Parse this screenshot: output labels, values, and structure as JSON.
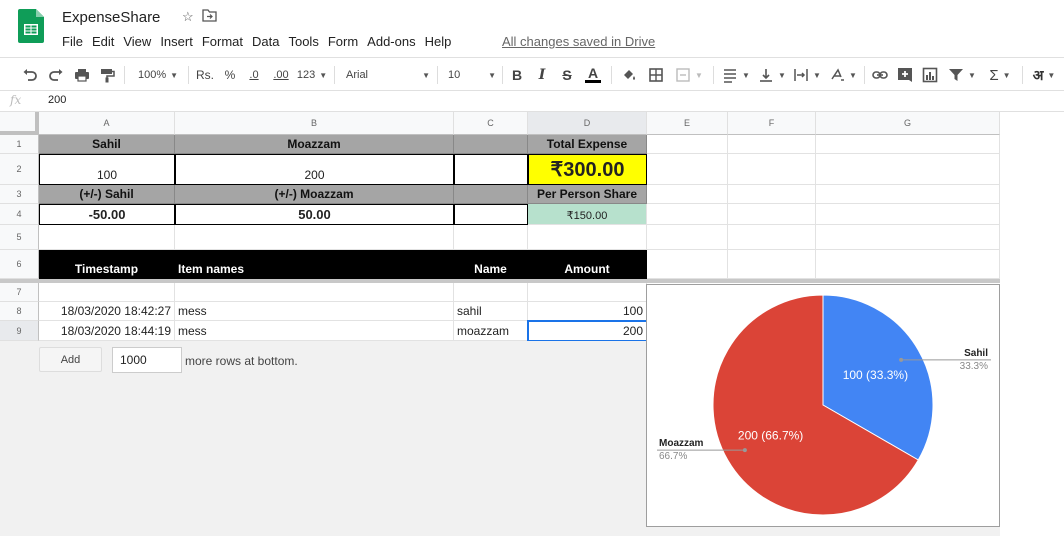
{
  "app": {
    "doc_title": "ExpenseShare",
    "saved_status": "All changes saved in Drive",
    "menu": [
      "File",
      "Edit",
      "View",
      "Insert",
      "Format",
      "Data",
      "Tools",
      "Form",
      "Add-ons",
      "Help"
    ]
  },
  "toolbar": {
    "zoom": "100%",
    "currency": "Rs.",
    "percent": "%",
    "dec_decrease": ".0",
    "dec_increase": ".00",
    "number_format": "123",
    "font": "Arial",
    "font_size": "10",
    "bold": "B",
    "italic": "I",
    "strike": "S",
    "text_color": "A",
    "sigma": "Σ",
    "input_tools": "अ"
  },
  "formula_bar": {
    "fx": "fx",
    "value": "200"
  },
  "columns": [
    "A",
    "B",
    "C",
    "D",
    "E",
    "F",
    "G"
  ],
  "rows": [
    "1",
    "2",
    "3",
    "4",
    "5",
    "6",
    "7",
    "8",
    "9"
  ],
  "sheet": {
    "a1": "Sahil",
    "b1": "Moazzam",
    "d1": "Total Expense",
    "a2": "100",
    "b2": "200",
    "d2": "₹300.00",
    "a3": "(+/-) Sahil",
    "b3": "(+/-) Moazzam",
    "d3": "Per Person Share",
    "a4": "-50.00",
    "b4": "50.00",
    "d4": "₹150.00",
    "a6": "Timestamp",
    "b6": "Item names",
    "c6": "Name",
    "d6": "Amount",
    "a8": "18/03/2020 18:42:27",
    "b8": "mess",
    "c8": "sahil",
    "d8": "100",
    "a9": "18/03/2020 18:44:19",
    "b9": "mess",
    "c9": "moazzam",
    "d9": "200"
  },
  "add_rows": {
    "button": "Add",
    "count": "1000",
    "text": "more rows at bottom."
  },
  "chart_data": {
    "type": "pie",
    "slices": [
      {
        "name": "Sahil",
        "value": 100,
        "percent": "33.3%",
        "label": "100 (33.3%)",
        "color": "#4285f4"
      },
      {
        "name": "Moazzam",
        "value": 200,
        "percent": "66.7%",
        "label": "200 (66.7%)",
        "color": "#db4437"
      }
    ],
    "legend": "labeled"
  }
}
